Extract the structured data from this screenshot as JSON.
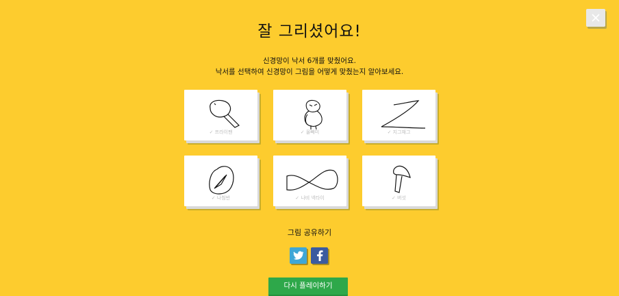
{
  "header": {
    "title": "잘 그리셨어요!",
    "subtitle_line1": "신경망이 낙서 6개를 맞췄어요.",
    "subtitle_line2": "낙서를 선택하여 신경망이 그림을 어떻게 맞췄는지 알아보세요."
  },
  "doodles": [
    {
      "label": "✓ 프라이팬",
      "icon": "frying-pan"
    },
    {
      "label": "✓ 올빼미",
      "icon": "owl"
    },
    {
      "label": "✓ 지그재그",
      "icon": "zigzag"
    },
    {
      "label": "✓ 나침반",
      "icon": "compass"
    },
    {
      "label": "✓ 나비 넥타이",
      "icon": "bowtie"
    },
    {
      "label": "✓ 버섯",
      "icon": "mushroom"
    }
  ],
  "share": {
    "label": "그림 공유하기",
    "twitter_icon": "twitter-icon",
    "facebook_icon": "facebook-icon"
  },
  "actions": {
    "replay_label": "다시  플레이하기",
    "close_icon": "close-icon"
  },
  "colors": {
    "background": "#fdcc2e",
    "replay_button": "#2ea84a",
    "twitter": "#3fa7d6",
    "facebook": "#3b5b9f"
  }
}
